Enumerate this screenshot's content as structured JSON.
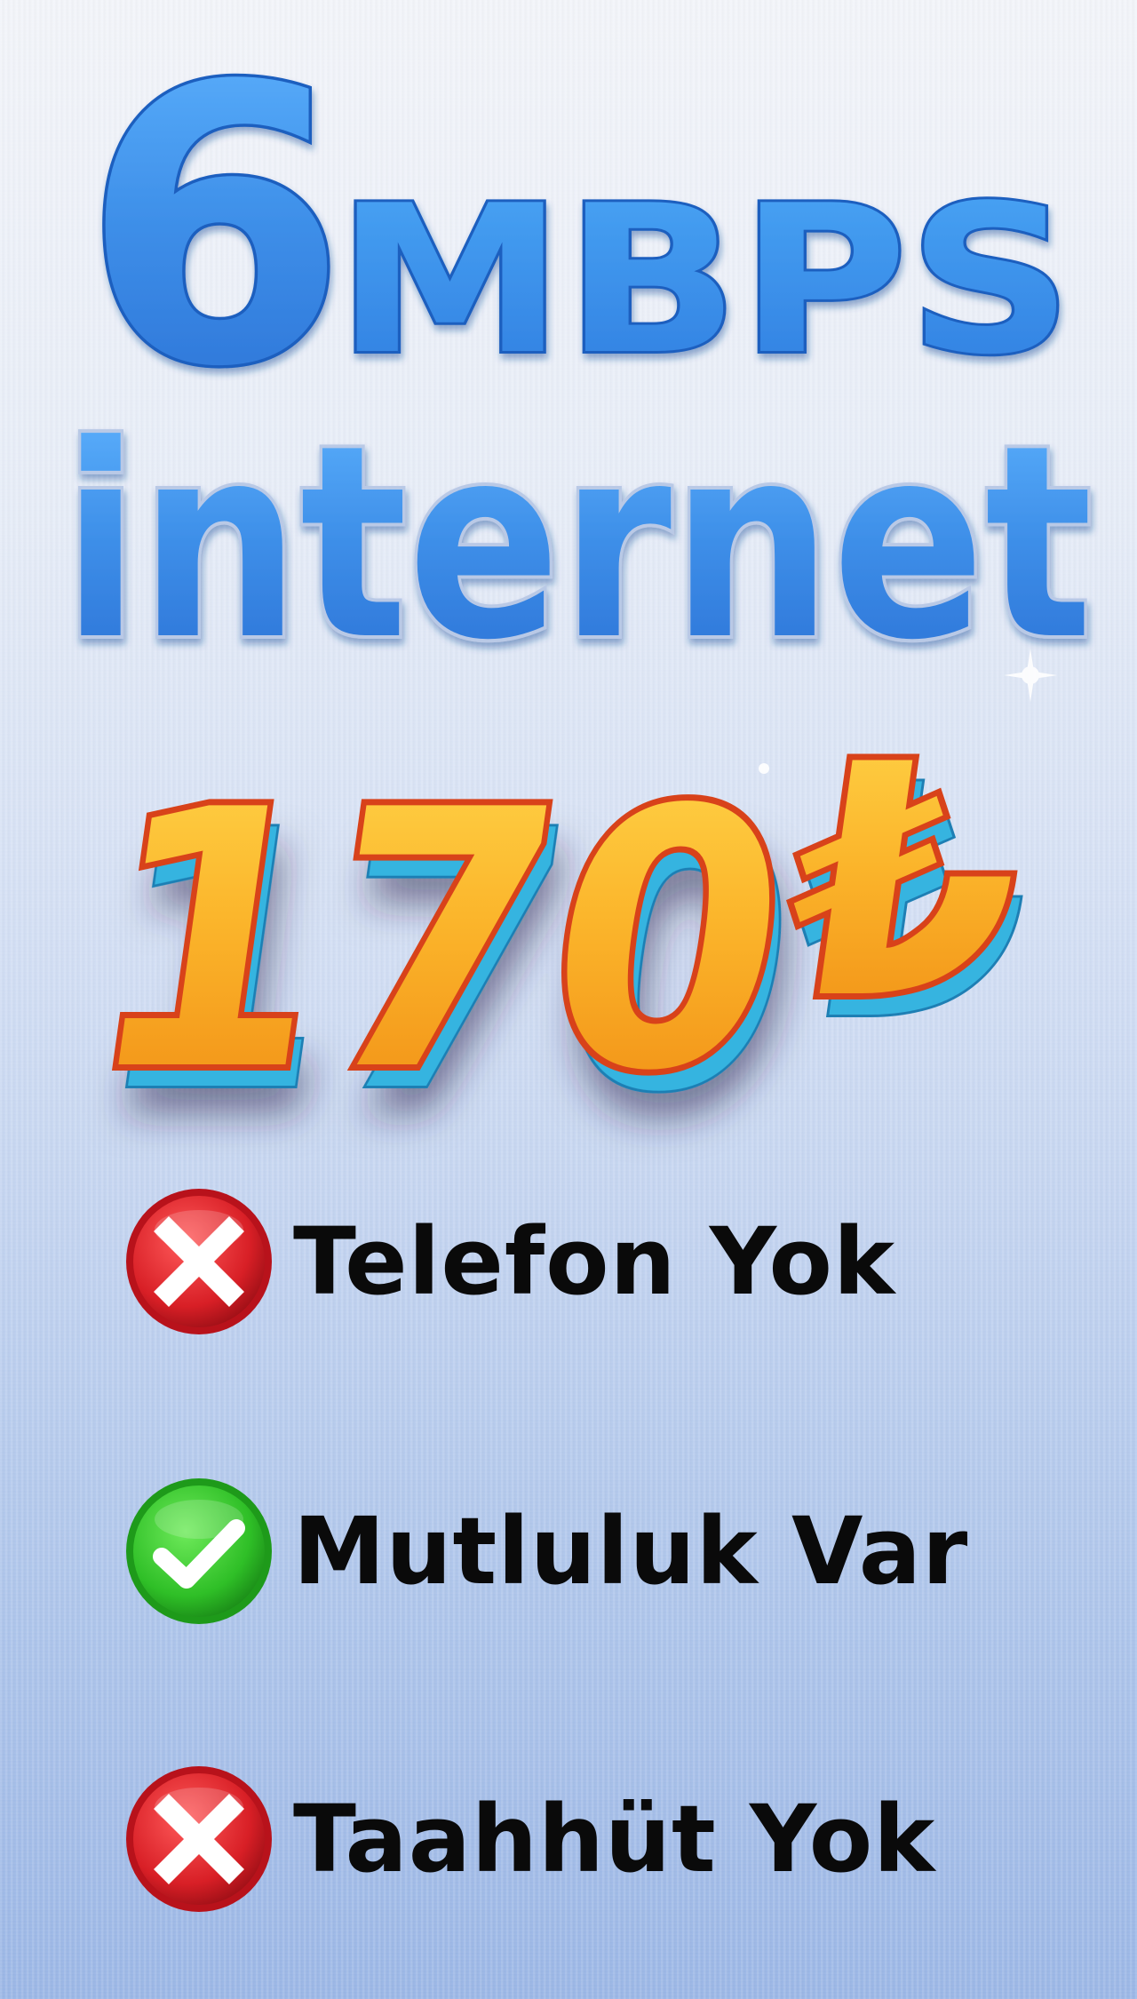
{
  "speed": {
    "number": "6",
    "unit": "MBPS",
    "service": "internet"
  },
  "price": {
    "amount": "170",
    "currency": "₺"
  },
  "features": [
    {
      "label": "Telefon Yok",
      "status": "no",
      "icon": "x-mark-icon",
      "color": "#d81f26"
    },
    {
      "label": "Mutluluk Var",
      "status": "yes",
      "icon": "check-mark-icon",
      "color": "#2fbf27"
    },
    {
      "label": "Taahhüt Yok",
      "status": "no",
      "icon": "x-mark-icon",
      "color": "#d81f26"
    }
  ],
  "colors": {
    "speed_text": "#3d8ee8",
    "price_text": "#f7a21b",
    "price_outline": "#d8421a",
    "price_shadow_edge": "#36b4e0",
    "background_top": "#f2f4f9",
    "background_bottom": "#9ab6e6"
  }
}
